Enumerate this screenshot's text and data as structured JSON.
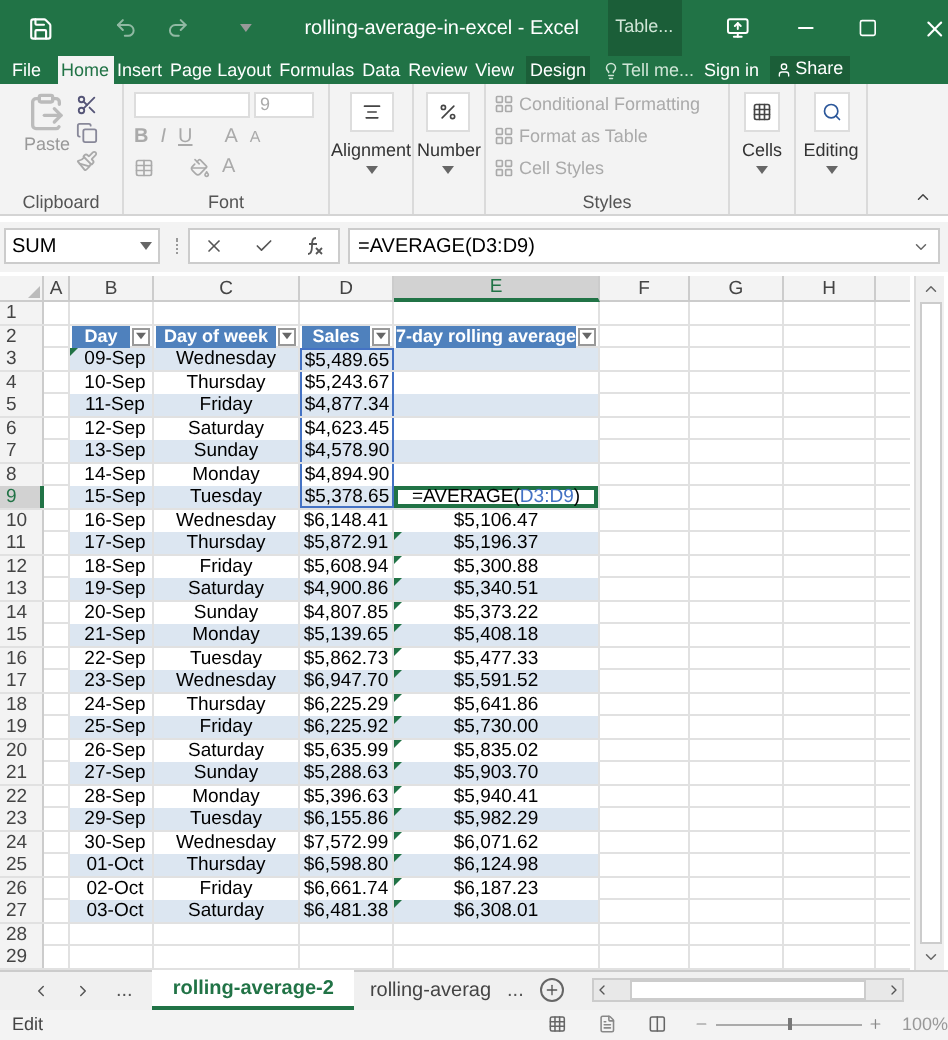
{
  "window": {
    "title": "rolling-average-in-excel - Excel",
    "context_tab": "Table..."
  },
  "ribbon_tabs": [
    {
      "label": "File",
      "selected": false
    },
    {
      "label": "Home",
      "selected": true
    },
    {
      "label": "Insert",
      "selected": false
    },
    {
      "label": "Page Layout",
      "selected": false
    },
    {
      "label": "Formulas",
      "selected": false
    },
    {
      "label": "Data",
      "selected": false
    },
    {
      "label": "Review",
      "selected": false
    },
    {
      "label": "View",
      "selected": false
    },
    {
      "label": "Design",
      "selected": false
    }
  ],
  "tell_me": "Tell me...",
  "sign_in": "Sign in",
  "share": "Share",
  "ribbon": {
    "clipboard": {
      "paste": "Paste",
      "label": "Clipboard"
    },
    "font": {
      "size": "9",
      "bold": "B",
      "italic": "I",
      "underline": "U",
      "grow": "A",
      "shrink": "A",
      "font_color_letter": "A",
      "label": "Font"
    },
    "alignment": {
      "label": "Alignment"
    },
    "number": {
      "label": "Number"
    },
    "styles": {
      "items": [
        {
          "label": "Conditional Formatting",
          "disabled": true
        },
        {
          "label": "Format as Table",
          "disabled": true
        },
        {
          "label": "Cell Styles",
          "disabled": true
        }
      ],
      "label": "Styles"
    },
    "cells": {
      "label": "Cells"
    },
    "editing": {
      "label": "Editing"
    }
  },
  "formula_bar": {
    "name_box": "SUM",
    "formula": "=AVERAGE(D3:D9)"
  },
  "columns": [
    {
      "label": "A",
      "selected": false
    },
    {
      "label": "B",
      "selected": false
    },
    {
      "label": "C",
      "selected": false
    },
    {
      "label": "D",
      "selected": false
    },
    {
      "label": "E",
      "selected": true
    },
    {
      "label": "F",
      "selected": false
    },
    {
      "label": "G",
      "selected": false
    },
    {
      "label": "H",
      "selected": false
    }
  ],
  "row_numbers": [
    {
      "label": "1",
      "selected": false
    },
    {
      "label": "2",
      "selected": false
    },
    {
      "label": "3",
      "selected": false
    },
    {
      "label": "4",
      "selected": false
    },
    {
      "label": "5",
      "selected": false
    },
    {
      "label": "6",
      "selected": false
    },
    {
      "label": "7",
      "selected": false
    },
    {
      "label": "8",
      "selected": false
    },
    {
      "label": "9",
      "selected": true
    },
    {
      "label": "10",
      "selected": false
    },
    {
      "label": "11",
      "selected": false
    },
    {
      "label": "12",
      "selected": false
    },
    {
      "label": "13",
      "selected": false
    },
    {
      "label": "14",
      "selected": false
    },
    {
      "label": "15",
      "selected": false
    },
    {
      "label": "16",
      "selected": false
    },
    {
      "label": "17",
      "selected": false
    },
    {
      "label": "18",
      "selected": false
    },
    {
      "label": "19",
      "selected": false
    },
    {
      "label": "20",
      "selected": false
    },
    {
      "label": "21",
      "selected": false
    },
    {
      "label": "22",
      "selected": false
    },
    {
      "label": "23",
      "selected": false
    },
    {
      "label": "24",
      "selected": false
    },
    {
      "label": "25",
      "selected": false
    },
    {
      "label": "26",
      "selected": false
    },
    {
      "label": "27",
      "selected": false
    },
    {
      "label": "28",
      "selected": false
    },
    {
      "label": "29",
      "selected": false
    }
  ],
  "table": {
    "headers": [
      "Day",
      "Day of week",
      "Sales",
      "7-day rolling average"
    ],
    "rows": [
      {
        "day": "09-Sep",
        "weekday": "Wednesday",
        "sales": "$5,489.65",
        "referenced": true,
        "day_flagged": true,
        "average_flagged": false
      },
      {
        "day": "10-Sep",
        "weekday": "Thursday",
        "sales": "$5,243.67",
        "referenced": true,
        "day_flagged": false,
        "average_flagged": false
      },
      {
        "day": "11-Sep",
        "weekday": "Friday",
        "sales": "$4,877.34",
        "referenced": true,
        "day_flagged": false,
        "average_flagged": false
      },
      {
        "day": "12-Sep",
        "weekday": "Saturday",
        "sales": "$4,623.45",
        "referenced": true,
        "day_flagged": false,
        "average_flagged": false
      },
      {
        "day": "13-Sep",
        "weekday": "Sunday",
        "sales": "$4,578.90",
        "referenced": true,
        "day_flagged": false,
        "average_flagged": false
      },
      {
        "day": "14-Sep",
        "weekday": "Monday",
        "sales": "$4,894.90",
        "referenced": true,
        "day_flagged": false,
        "average_flagged": false
      },
      {
        "day": "15-Sep",
        "weekday": "Tuesday",
        "sales": "$5,378.65",
        "referenced": true,
        "day_flagged": false,
        "average_flagged": false,
        "edit_formula": {
          "before": "=AVERAGE(",
          "reference": "D3:D9",
          "after": ")"
        }
      },
      {
        "day": "16-Sep",
        "weekday": "Wednesday",
        "sales": "$6,148.41",
        "referenced": false,
        "day_flagged": false,
        "average_flagged": false,
        "average": "$5,106.47"
      },
      {
        "day": "17-Sep",
        "weekday": "Thursday",
        "sales": "$5,872.91",
        "referenced": false,
        "day_flagged": false,
        "average_flagged": true,
        "average": "$5,196.37"
      },
      {
        "day": "18-Sep",
        "weekday": "Friday",
        "sales": "$5,608.94",
        "referenced": false,
        "day_flagged": false,
        "average_flagged": true,
        "average": "$5,300.88"
      },
      {
        "day": "19-Sep",
        "weekday": "Saturday",
        "sales": "$4,900.86",
        "referenced": false,
        "day_flagged": false,
        "average_flagged": true,
        "average": "$5,340.51"
      },
      {
        "day": "20-Sep",
        "weekday": "Sunday",
        "sales": "$4,807.85",
        "referenced": false,
        "day_flagged": false,
        "average_flagged": true,
        "average": "$5,373.22"
      },
      {
        "day": "21-Sep",
        "weekday": "Monday",
        "sales": "$5,139.65",
        "referenced": false,
        "day_flagged": false,
        "average_flagged": true,
        "average": "$5,408.18"
      },
      {
        "day": "22-Sep",
        "weekday": "Tuesday",
        "sales": "$5,862.73",
        "referenced": false,
        "day_flagged": false,
        "average_flagged": true,
        "average": "$5,477.33"
      },
      {
        "day": "23-Sep",
        "weekday": "Wednesday",
        "sales": "$6,947.70",
        "referenced": false,
        "day_flagged": false,
        "average_flagged": true,
        "average": "$5,591.52"
      },
      {
        "day": "24-Sep",
        "weekday": "Thursday",
        "sales": "$6,225.29",
        "referenced": false,
        "day_flagged": false,
        "average_flagged": true,
        "average": "$5,641.86"
      },
      {
        "day": "25-Sep",
        "weekday": "Friday",
        "sales": "$6,225.92",
        "referenced": false,
        "day_flagged": false,
        "average_flagged": true,
        "average": "$5,730.00"
      },
      {
        "day": "26-Sep",
        "weekday": "Saturday",
        "sales": "$5,635.99",
        "referenced": false,
        "day_flagged": false,
        "average_flagged": true,
        "average": "$5,835.02"
      },
      {
        "day": "27-Sep",
        "weekday": "Sunday",
        "sales": "$5,288.63",
        "referenced": false,
        "day_flagged": false,
        "average_flagged": true,
        "average": "$5,903.70"
      },
      {
        "day": "28-Sep",
        "weekday": "Monday",
        "sales": "$5,396.63",
        "referenced": false,
        "day_flagged": false,
        "average_flagged": true,
        "average": "$5,940.41"
      },
      {
        "day": "29-Sep",
        "weekday": "Tuesday",
        "sales": "$6,155.86",
        "referenced": false,
        "day_flagged": false,
        "average_flagged": true,
        "average": "$5,982.29"
      },
      {
        "day": "30-Sep",
        "weekday": "Wednesday",
        "sales": "$7,572.99",
        "referenced": false,
        "day_flagged": false,
        "average_flagged": true,
        "average": "$6,071.62"
      },
      {
        "day": "01-Oct",
        "weekday": "Thursday",
        "sales": "$6,598.80",
        "referenced": false,
        "day_flagged": false,
        "average_flagged": true,
        "average": "$6,124.98"
      },
      {
        "day": "02-Oct",
        "weekday": "Friday",
        "sales": "$6,661.74",
        "referenced": false,
        "day_flagged": false,
        "average_flagged": true,
        "average": "$6,187.23"
      },
      {
        "day": "03-Oct",
        "weekday": "Saturday",
        "sales": "$6,481.38",
        "referenced": false,
        "day_flagged": false,
        "average_flagged": true,
        "average": "$6,308.01"
      }
    ]
  },
  "sheet_tabs": {
    "leading_more": "...",
    "tabs": [
      {
        "label": "rolling-average-2",
        "selected": true
      },
      {
        "label": "rolling-averag",
        "selected": false
      }
    ],
    "trailing_more": "..."
  },
  "status_bar": {
    "mode": "Edit",
    "zoom": {
      "level": 0.5,
      "reading": "100%"
    }
  }
}
